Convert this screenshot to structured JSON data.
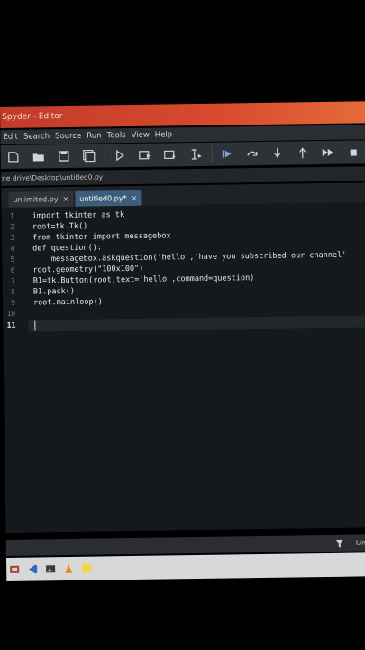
{
  "window": {
    "title": "Spyder - Editor"
  },
  "menu": [
    "Edit",
    "Search",
    "Source",
    "Run",
    "Tools",
    "View",
    "Help"
  ],
  "toolbar_icons": [
    "new-file-icon",
    "open-folder-icon",
    "save-icon",
    "save-all-icon",
    "run-icon",
    "run-cell-icon",
    "run-cell-advance-icon",
    "run-selection-icon",
    "debug-icon",
    "step-icon",
    "step-into-icon",
    "step-return-icon",
    "continue-icon",
    "stop-icon"
  ],
  "path": "ne drive\\Desktop\\untitled0.py",
  "tabs": [
    {
      "label": "unlimited.py",
      "close": "×"
    },
    {
      "label": "untitled0.py*",
      "close": "×"
    }
  ],
  "editor": {
    "line_numbers": [
      "1",
      "2",
      "3",
      "4",
      "5",
      "6",
      "7",
      "8",
      "9",
      "10",
      "11"
    ],
    "current_line": "11",
    "lines": [
      "import tkinter as tk",
      "root=tk.Tk()",
      "from tkinter import messagebox",
      "def question():",
      "    messagebox.askquestion('hello','have you subscribed our channel'",
      "root.geometry(\"100x100\")",
      "B1=tk.Button(root,text='hello',command=question)",
      "B1.pack()",
      "root.mainloop()",
      "",
      ""
    ]
  },
  "status": {
    "right": "Line"
  },
  "taskbar_icons": [
    "paint-icon",
    "vscode-icon",
    "photos-icon",
    "vlc-icon",
    "sticky-notes-icon"
  ]
}
